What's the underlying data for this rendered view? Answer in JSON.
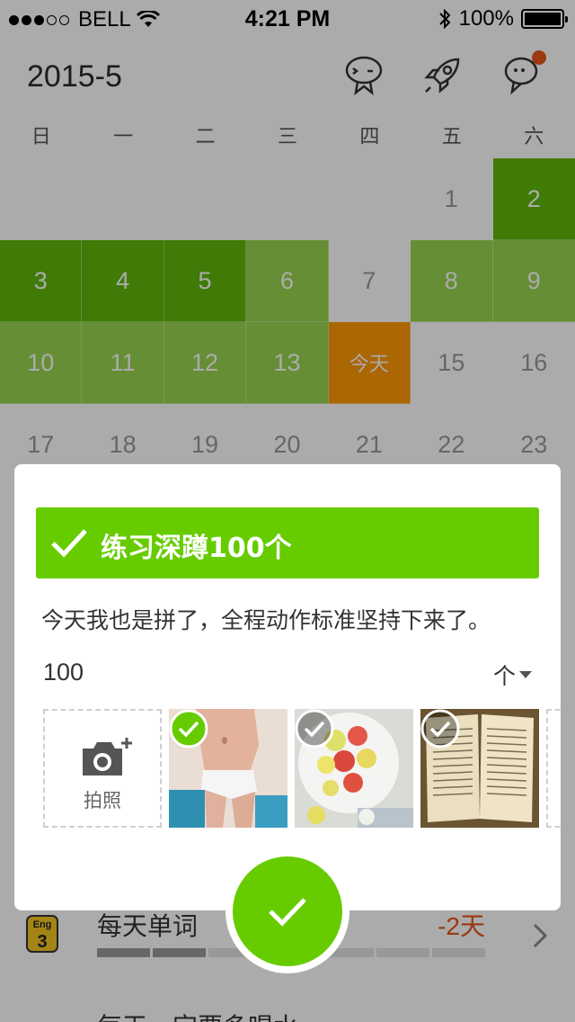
{
  "status_bar": {
    "carrier": "BELL",
    "time": "4:21 PM",
    "battery": "100%",
    "signal_bars_filled": 3,
    "signal_bars_total": 5
  },
  "header": {
    "month": "2015-5",
    "icons": [
      "monster-face-icon",
      "rocket-icon",
      "chat-bubble-icon"
    ],
    "notification_color": "#e8551c"
  },
  "calendar": {
    "weekdays": [
      "日",
      "一",
      "二",
      "三",
      "四",
      "五",
      "六"
    ],
    "rows": [
      [
        {
          "label": "",
          "level": 0
        },
        {
          "label": "",
          "level": 0
        },
        {
          "label": "",
          "level": 0
        },
        {
          "label": "",
          "level": 0
        },
        {
          "label": "",
          "level": 0
        },
        {
          "label": "1",
          "level": 0
        },
        {
          "label": "2",
          "level": 2
        }
      ],
      [
        {
          "label": "3",
          "level": 2
        },
        {
          "label": "4",
          "level": 2
        },
        {
          "label": "5",
          "level": 2
        },
        {
          "label": "6",
          "level": 1
        },
        {
          "label": "7",
          "level": 0
        },
        {
          "label": "8",
          "level": 1
        },
        {
          "label": "9",
          "level": 1
        }
      ],
      [
        {
          "label": "10",
          "level": 1
        },
        {
          "label": "11",
          "level": 1
        },
        {
          "label": "12",
          "level": 1
        },
        {
          "label": "13",
          "level": 1
        },
        {
          "label": "今天",
          "level": "today"
        },
        {
          "label": "15",
          "level": 0
        },
        {
          "label": "16",
          "level": 0
        }
      ],
      [
        {
          "label": "17",
          "level": 0
        },
        {
          "label": "18",
          "level": 0
        },
        {
          "label": "19",
          "level": 0
        },
        {
          "label": "20",
          "level": 0
        },
        {
          "label": "21",
          "level": 0
        },
        {
          "label": "22",
          "level": 0
        },
        {
          "label": "23",
          "level": 0
        }
      ]
    ],
    "colors": {
      "level_1": "#99d44e",
      "level_2": "#5fb80a",
      "today": "#ff9a07"
    }
  },
  "dialog": {
    "task_title": "练习深蹲100个",
    "note": "今天我也是拼了，全程动作标准坚持下来了。",
    "count_value": "100",
    "unit": "个",
    "add_photo_label": "拍照",
    "photos": [
      {
        "subject": "body-photo",
        "selected": true
      },
      {
        "subject": "apples-photo",
        "selected": false
      },
      {
        "subject": "book-photo",
        "selected": false
      }
    ],
    "accent": "#66cc00"
  },
  "habits": [
    {
      "name": "每天单词",
      "days": "-2天",
      "badge_text": "Eng",
      "badge_number": "3",
      "progress_done": 2,
      "progress_total": 7
    },
    {
      "name": "每天一定要多喝水"
    }
  ]
}
